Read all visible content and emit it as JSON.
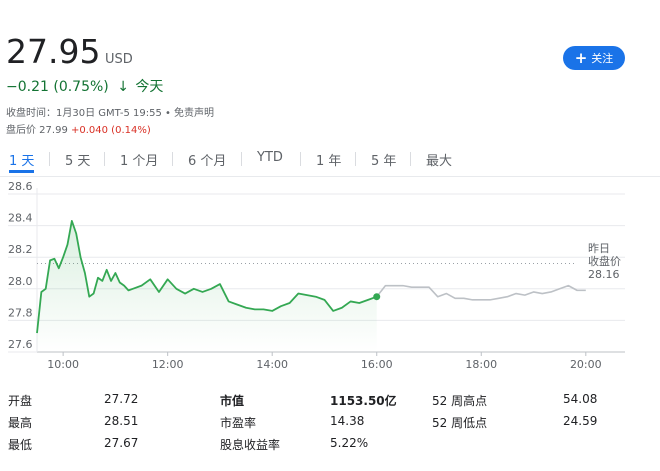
{
  "quote": {
    "price": "27.95",
    "currency": "USD",
    "change": "−0.21 (0.75%)",
    "period": "今天",
    "close_info": "收盘时间：1月30日 GMT-5 19:55 • 免责声明",
    "after_hours_prefix": "盘后价 27.99",
    "after_hours_change": "+0.040 (0.14%)",
    "follow_label": "关注"
  },
  "colors": {
    "accent": "#1a73e8",
    "down": "#137333",
    "up": "#d93025",
    "line": "#34a853",
    "after_hours_line": "#bdc1c6"
  },
  "tabs": [
    "1 天",
    "5 天",
    "1 个月",
    "6 个月",
    "YTD",
    "1 年",
    "5 年",
    "最大"
  ],
  "active_tab": "1 天",
  "chart_data": {
    "type": "line",
    "y_ticks": [
      "28.6",
      "28.4",
      "28.2",
      "28.0",
      "27.8",
      "27.6"
    ],
    "x_ticks": [
      "10:00",
      "12:00",
      "14:00",
      "16:00",
      "18:00",
      "20:00"
    ],
    "ylim": [
      27.6,
      28.6
    ],
    "xlim": [
      "09:30",
      "20:45"
    ],
    "grid": true,
    "previous_close": {
      "value": 28.16,
      "label_line1": "昨日",
      "label_line2": "收盘价",
      "label_line3": "28.16"
    },
    "series": [
      {
        "x": [
          "09:30",
          "09:35",
          "09:40",
          "09:45",
          "09:50",
          "09:55",
          "10:00",
          "10:05",
          "10:10",
          "10:15",
          "10:20",
          "10:25",
          "10:30",
          "10:35",
          "10:40",
          "10:45",
          "10:50",
          "10:55",
          "11:00",
          "11:05",
          "11:10",
          "11:15",
          "11:20",
          "11:30",
          "11:40",
          "11:50",
          "12:00",
          "12:10",
          "12:20",
          "12:30",
          "12:40",
          "12:50",
          "13:00",
          "13:10",
          "13:20",
          "13:30",
          "13:40",
          "13:50",
          "14:00",
          "14:10",
          "14:20",
          "14:30",
          "14:40",
          "14:50",
          "15:00",
          "15:10",
          "15:20",
          "15:30",
          "15:40",
          "15:50",
          "16:00"
        ],
        "values": [
          27.72,
          27.98,
          28.0,
          28.18,
          28.19,
          28.13,
          28.2,
          28.28,
          28.43,
          28.35,
          28.2,
          28.1,
          27.95,
          27.97,
          28.07,
          28.05,
          28.12,
          28.05,
          28.1,
          28.04,
          28.02,
          27.99,
          28.0,
          28.02,
          28.06,
          27.98,
          28.06,
          28.0,
          27.97,
          28.0,
          27.98,
          28.0,
          28.03,
          27.92,
          27.9,
          27.88,
          27.87,
          27.87,
          27.86,
          27.89,
          27.91,
          27.97,
          27.96,
          27.95,
          27.93,
          27.86,
          27.88,
          27.92,
          27.91,
          27.93,
          27.95
        ]
      },
      {
        "x": [
          "16:00",
          "16:10",
          "16:20",
          "16:30",
          "16:40",
          "16:50",
          "17:00",
          "17:10",
          "17:20",
          "17:30",
          "17:40",
          "17:50",
          "18:00",
          "18:10",
          "18:20",
          "18:30",
          "18:40",
          "18:50",
          "19:00",
          "19:10",
          "19:20",
          "19:30",
          "19:40",
          "19:50",
          "20:00"
        ],
        "values": [
          27.95,
          28.02,
          28.02,
          28.02,
          28.01,
          28.01,
          28.01,
          27.95,
          27.97,
          27.94,
          27.94,
          27.93,
          27.93,
          27.93,
          27.94,
          27.95,
          27.97,
          27.96,
          27.98,
          27.97,
          27.98,
          28.0,
          28.02,
          27.99,
          27.99
        ]
      }
    ]
  },
  "stats": [
    {
      "label": "开盘",
      "value": "27.72"
    },
    {
      "label": "最高",
      "value": "28.51"
    },
    {
      "label": "最低",
      "value": "27.67"
    },
    {
      "label": "市值",
      "value": "1153.50亿"
    },
    {
      "label": "市盈率",
      "value": "14.38"
    },
    {
      "label": "股息收益率",
      "value": "5.22%"
    },
    {
      "label": "52 周高点",
      "value": "54.08"
    },
    {
      "label": "52 周低点",
      "value": "24.59"
    }
  ]
}
